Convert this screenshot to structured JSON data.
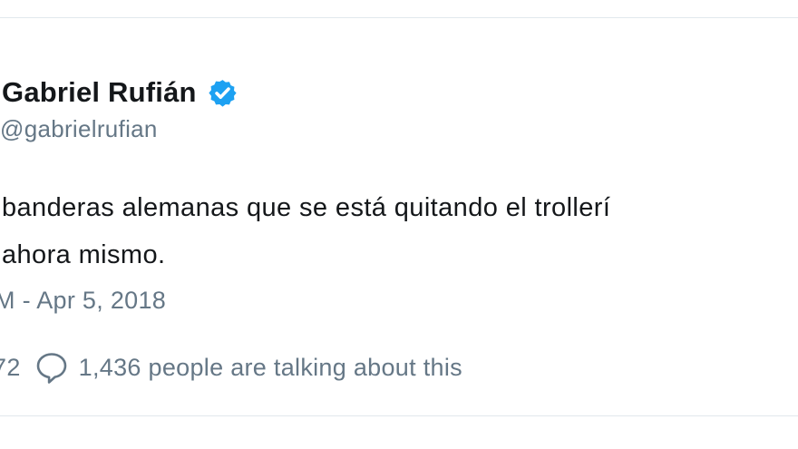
{
  "tweet": {
    "author_name": "Gabriel Rufián",
    "handle": "@gabrielrufian",
    "verified_icon": "verified-badge-icon",
    "accent_color": "#1da1f2",
    "text_lines": [
      "banderas alemanas que se está quitando el trollerí",
      "ahora mismo."
    ],
    "timestamp": "M - Apr 5, 2018",
    "like_count": "72",
    "reply_icon": "speech-bubble-icon",
    "talking_label": "1,436 people are talking about this"
  }
}
